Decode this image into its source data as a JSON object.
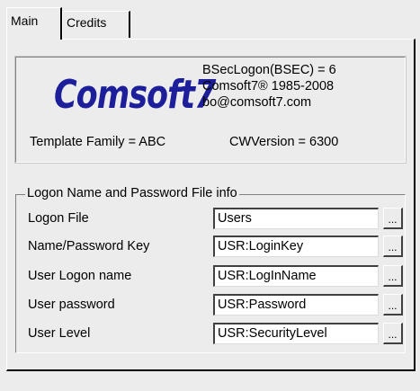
{
  "tabs": [
    {
      "label": "Main",
      "selected": true
    },
    {
      "label": "Credits",
      "selected": false
    }
  ],
  "info": {
    "logo_text": "Comsoft7",
    "logo_color": "#1c1e9a",
    "bsec_logon": "BSecLogon(BSEC) = 6",
    "copyright": "Comsoft7® 1985-2008",
    "email": "bo@comsoft7.com",
    "template_family": "Template Family = ABC",
    "cw_version": "CWVersion = 6300"
  },
  "group": {
    "title": "Logon Name and Password File info",
    "rows": [
      {
        "label": "Logon File",
        "value": "Users",
        "button": "..."
      },
      {
        "label": "Name/Password Key",
        "value": "USR:LoginKey",
        "button": "..."
      },
      {
        "label": "User Logon name",
        "value": "USR:LogInName",
        "button": "..."
      },
      {
        "label": "User password",
        "value": "USR:Password",
        "button": "..."
      },
      {
        "label": "User Level",
        "value": "USR:SecurityLevel",
        "button": "..."
      }
    ]
  }
}
